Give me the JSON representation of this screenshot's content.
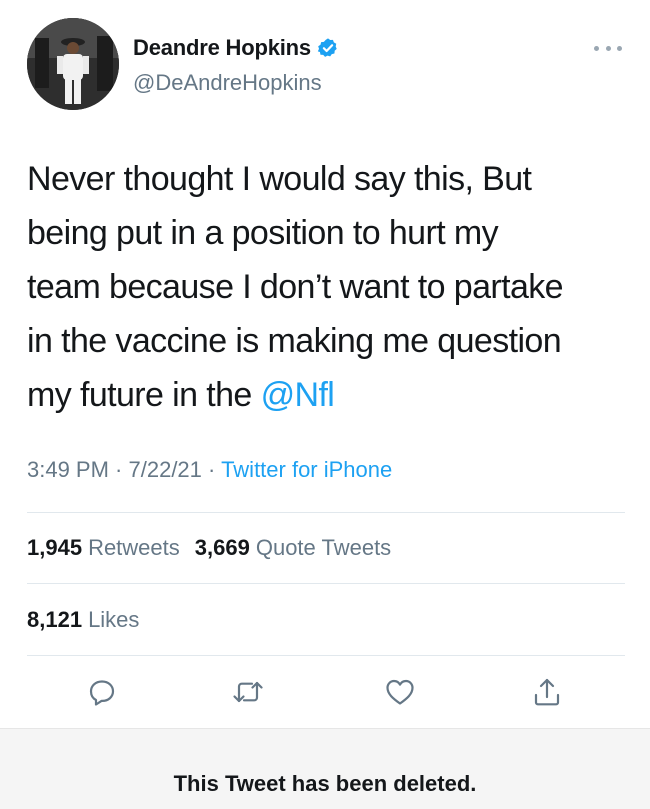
{
  "author": {
    "display_name": "Deandre Hopkins",
    "handle": "@DeAndreHopkins",
    "verified": true
  },
  "tweet": {
    "lines": [
      "Never thought I would say this, But",
      "being put in a position to hurt my",
      "team because I don’t want to partake",
      "in the vaccine is making me question"
    ],
    "last_line_prefix": "my future in the ",
    "mention": "@Nfl"
  },
  "meta": {
    "time": "3:49 PM",
    "separator1": " · ",
    "date": "7/22/21",
    "separator2": " · ",
    "source": "Twitter for iPhone"
  },
  "stats": {
    "retweets_count": "1,945",
    "retweets_label": "Retweets",
    "quote_count": "3,669",
    "quote_label": "Quote Tweets",
    "likes_count": "8,121",
    "likes_label": "Likes"
  },
  "icons": {
    "reply": "reply-icon",
    "retweet": "retweet-icon",
    "like": "like-icon",
    "share": "share-icon",
    "more": "more-icon",
    "verified": "verified-badge-icon"
  },
  "colors": {
    "accent": "#1da1f2",
    "secondary_text": "#657786",
    "primary_text": "#14171a",
    "divider": "#e1e8ed",
    "deleted_bar_bg": "#f5f5f5"
  },
  "deleted_notice": "This Tweet has been deleted."
}
